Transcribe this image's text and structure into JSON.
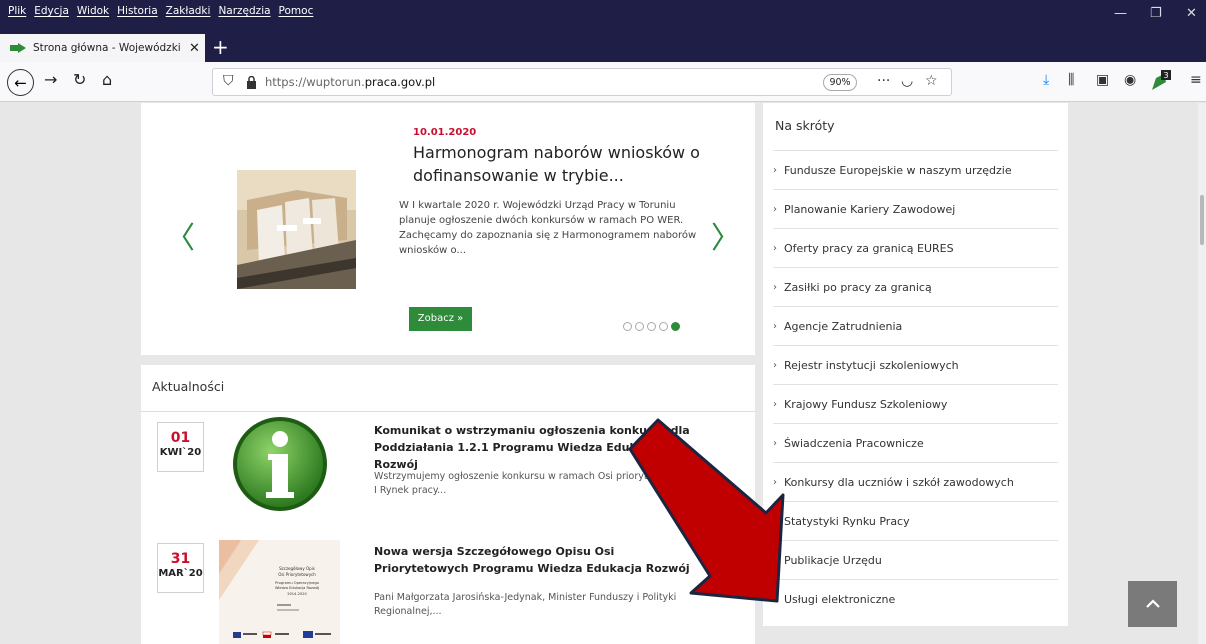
{
  "browser": {
    "menu": [
      "Plik",
      "Edycja",
      "Widok",
      "Historia",
      "Zakładki",
      "Narzędzia",
      "Pomoc"
    ],
    "tab_title": "Strona główna - Wojewódzki U",
    "url_prefix": "https://wuptorun.",
    "url_domain": "praca.gov.pl",
    "zoom": "90%",
    "extension_badge": "3"
  },
  "slider": {
    "date": "10.01.2020",
    "title": "Harmonogram naborów wniosków o dofinansowanie w trybie...",
    "description": "W I kwartale 2020 r. Wojewódzki Urząd Pracy w Toruniu planuje ogłoszenie dwóch konkursów w ramach PO WER. Zachęcamy do zapoznania się z Harmonogramem naborów wniosków o...",
    "button_label": "Zobacz »",
    "dots_total": 5,
    "active_dot": 5
  },
  "news": {
    "heading": "Aktualności",
    "items": [
      {
        "day": "01",
        "month": "KWI`20",
        "title": "Komunikat o wstrzymaniu ogłoszenia konkursu dla Poddziałania 1.2.1 Programu Wiedza Edukacja Rozwój",
        "description": "Wstrzymujemy ogłoszenie konkursu w ramach Osi priorytetowej I Rynek pracy..."
      },
      {
        "day": "31",
        "month": "MAR`20",
        "title": "Nowa wersja Szczegółowego Opisu Osi Priorytetowych Programu Wiedza Edukacja Rozwój",
        "description": "Pani Małgorzata Jarosińska-Jedynak, Minister Funduszy i Polityki Regionalnej,...",
        "thumb_lines": [
          "Szczegółowy Opis",
          "Osi Priorytetowych",
          "Programu Operacyjnego",
          "Wiedza Edukacja Rozwój",
          "2014-2020"
        ]
      }
    ]
  },
  "shortcuts": {
    "heading": "Na skróty",
    "items": [
      "Fundusze Europejskie w naszym urzędzie",
      "Planowanie Kariery Zawodowej",
      "Oferty pracy za granicą EURES",
      "Zasiłki po pracy za granicą",
      "Agencje Zatrudnienia",
      "Rejestr instytucji szkoleniowych",
      "Krajowy Fundusz Szkoleniowy",
      "Świadczenia Pracownicze",
      "Konkursy dla uczniów i szkół zawodowych",
      "Statystyki Rynku Pracy",
      "Publikacje Urzędu",
      "Usługi elektroniczne"
    ]
  },
  "colors": {
    "accent_green": "#2e8b3a",
    "date_red": "#c8102e",
    "arrow_red": "#c00000",
    "titlebar": "#1f1e46"
  }
}
